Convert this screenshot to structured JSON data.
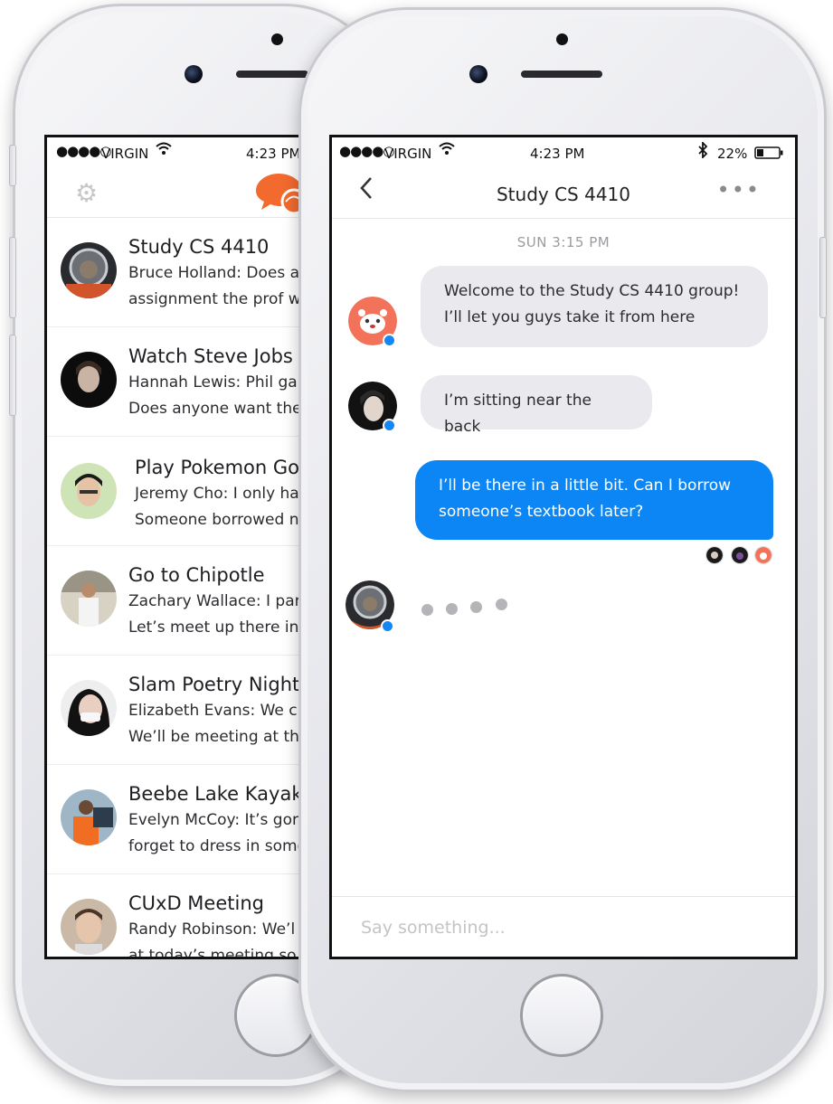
{
  "status_left": {
    "carrier": "VIRGIN",
    "time": "4:23 PM"
  },
  "status_right": {
    "carrier": "VIRGIN",
    "time": "4:23 PM",
    "battery": "22%"
  },
  "conversations": [
    {
      "title": "Study CS 4410",
      "line1": "Bruce Holland: Does a",
      "line2": "assignment the prof w"
    },
    {
      "title": "Watch Steve Jobs",
      "line1": "Hannah Lewis: Phil ga",
      "line2": "Does anyone want the"
    },
    {
      "title": "Play Pokemon Gold",
      "line1": "Jeremy Cho: I only ha",
      "line2": "Someone borrowed n"
    },
    {
      "title": "Go to Chipotle",
      "line1": "Zachary Wallace: I parl",
      "line2": "Let’s meet up there in"
    },
    {
      "title": "Slam Poetry Night",
      "line1": "Elizabeth Evans: We c",
      "line2": "We’ll be meeting at th"
    },
    {
      "title": "Beebe Lake Kayaking",
      "line1": "Evelyn McCoy: It’s gor",
      "line2": "forget to dress in some"
    },
    {
      "title": "CUxD Meeting",
      "line1": "Randy Robinson: We’l",
      "line2": "at today’s meeting so"
    }
  ],
  "chat": {
    "title": "Study CS 4410",
    "timestamp": "SUN 3:15 PM",
    "messages": [
      {
        "line1": "Welcome to the Study CS 4410 group!",
        "line2": "I’ll let you guys take it from here"
      },
      {
        "line1": "I’m sitting near the back"
      },
      {
        "line1": "I’ll be there in a little bit. Can I borrow",
        "line2": "someone’s textbook later?"
      }
    ],
    "composer_placeholder": "Say something..."
  },
  "colors": {
    "accent_orange": "#f26a2e",
    "outgoing_blue": "#0d86f5",
    "online_dot": "#1487f8"
  },
  "icons": [
    "settings-gear-icon",
    "chat-logo-icon",
    "back-chevron-icon",
    "more-dots-icon",
    "wifi-icon",
    "bluetooth-icon",
    "battery-icon"
  ]
}
